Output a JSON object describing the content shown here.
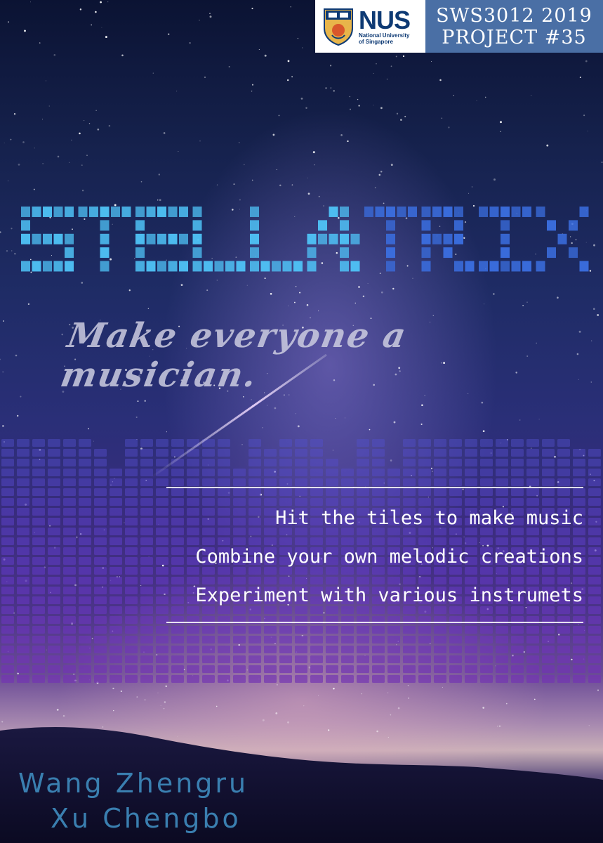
{
  "header": {
    "nus_abbr": "NUS",
    "nus_full_line1": "National University",
    "nus_full_line2": "of Singapore",
    "project_course": "SWS3012 2019",
    "project_number": "PROJECT #35"
  },
  "title": "STELLATRIX",
  "tagline": "Make everyone a musician.",
  "features": [
    "Hit the tiles to make music",
    "Combine your own melodic creations",
    "Experiment with various instrumets"
  ],
  "authors": [
    "Wang Zhengru",
    "Xu Chengbo"
  ],
  "colors": {
    "nus_blue": "#0e3a74",
    "project_badge": "#4a6fa5",
    "title_cyan": "#4fc3f7",
    "title_blue": "#3b6fe0",
    "author_blue": "#3a7fb0"
  }
}
